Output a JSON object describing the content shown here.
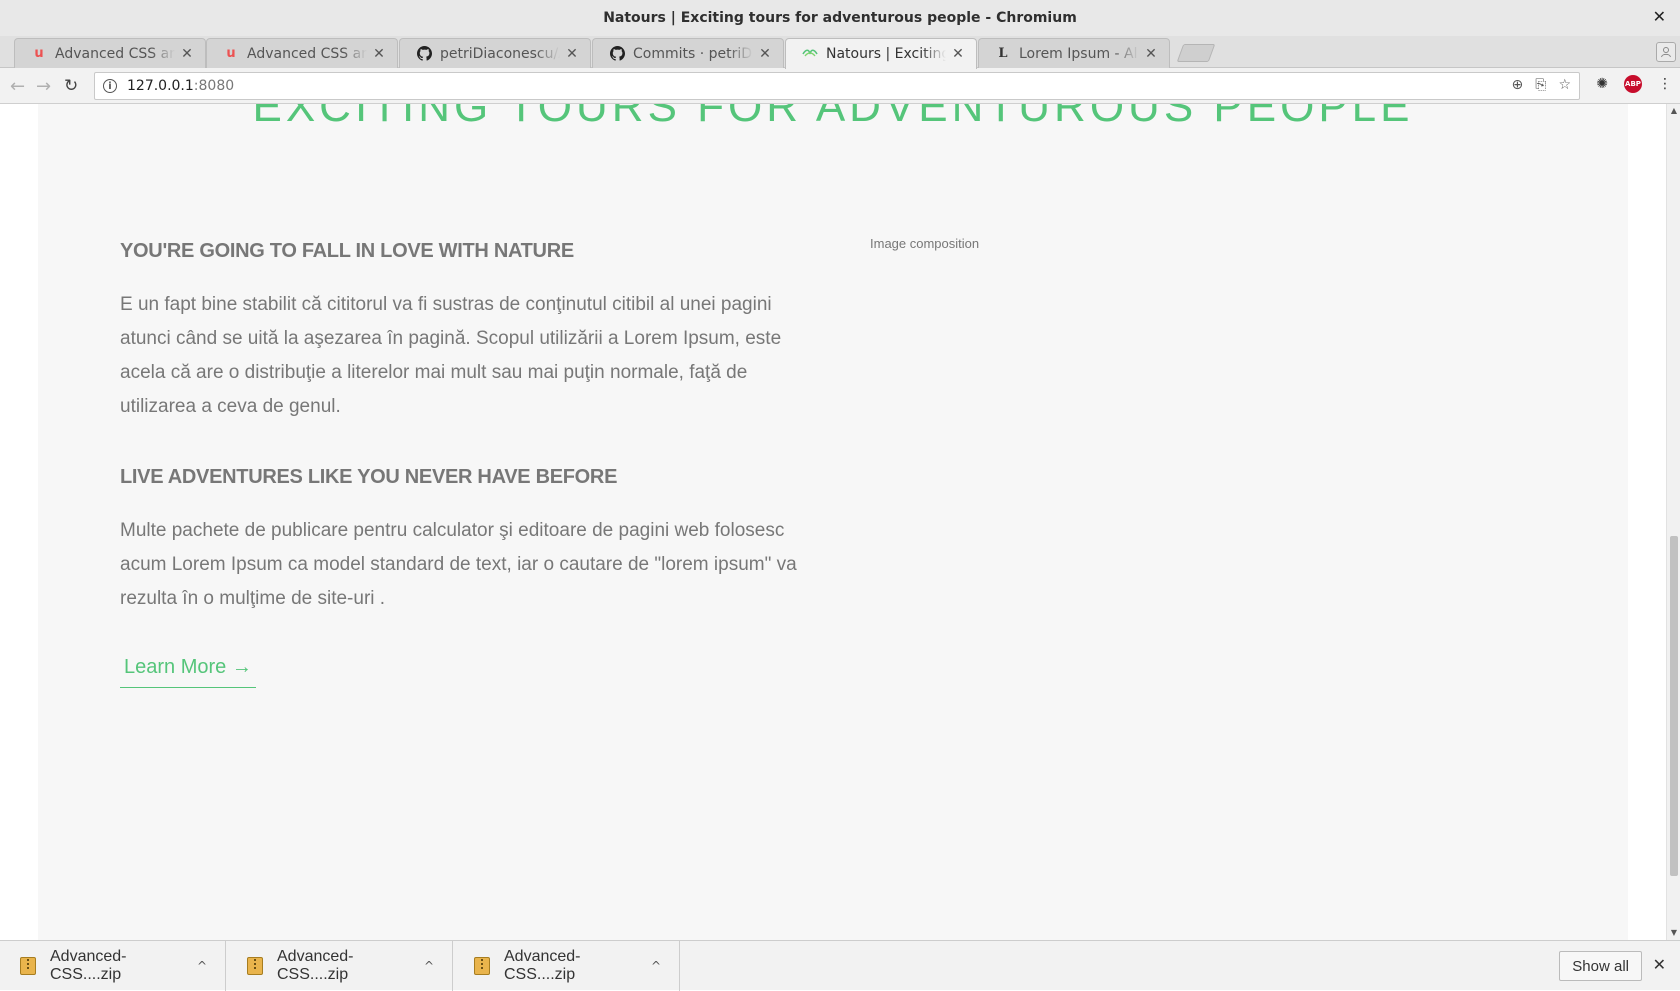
{
  "window": {
    "title": "Natours | Exciting tours for adventurous people - Chromium",
    "close_glyph": "✕"
  },
  "tabs": [
    {
      "label": "Advanced CSS and Sass",
      "icon": "u",
      "icon_color": "#ec5252",
      "active": false
    },
    {
      "label": "Advanced CSS and Sass",
      "icon": "u",
      "icon_color": "#ec5252",
      "active": false
    },
    {
      "label": "petriDiaconescu/Advanced-CSS",
      "icon": "github-icon",
      "icon_color": "#222222",
      "active": false
    },
    {
      "label": "Commits · petriDiaconescu",
      "icon": "github-icon",
      "icon_color": "#222222",
      "active": false
    },
    {
      "label": "Natours | Exciting tours",
      "icon": "natours-leaf-icon",
      "icon_color": "#55c57a",
      "active": true
    },
    {
      "label": "Lorem Ipsum - All the facts",
      "icon": "L",
      "icon_color": "#333333",
      "active": false
    }
  ],
  "tab_close_glyph": "✕",
  "toolbar": {
    "back_glyph": "←",
    "forward_glyph": "→",
    "reload_glyph": "↻",
    "url_host": "127.0.0.1",
    "url_port": ":8080",
    "info_glyph": "i",
    "zoom_glyph": "⊕",
    "translate_glyph": "⎘",
    "star_glyph": "☆",
    "ext_glyph": "✺",
    "abp_label": "ABP",
    "menu_glyph": "⋮"
  },
  "page": {
    "hero_heading": "EXCITING TOURS FOR ADVENTUROUS PEOPLE",
    "feature1_heading": "YOU'RE GOING TO FALL IN LOVE WITH NATURE",
    "feature1_text": "E un fapt bine stabilit că cititorul va fi sustras de conţinutul citibil al unei pagini atunci când se uită la aşezarea în pagină. Scopul utilizării a Lorem Ipsum, este acela că are o distribuţie a literelor mai mult sau mai puţin normale, faţă de utilizarea a ceva de genul.",
    "feature2_heading": "LIVE ADVENTURES LIKE YOU NEVER HAVE BEFORE",
    "feature2_text": "Multe pachete de publicare pentru calculator şi editoare de pagini web folosesc acum Lorem Ipsum ca model standard de text, iar o cautare de \"lorem ipsum\" va rezulta în o mulţime de site-uri .",
    "learn_more": "Learn More →",
    "image_composition": "Image composition"
  },
  "scrollbar": {
    "up_glyph": "▲",
    "down_glyph": "▼"
  },
  "downloads": {
    "items": [
      {
        "name": "Advanced-CSS....zip"
      },
      {
        "name": "Advanced-CSS....zip"
      },
      {
        "name": "Advanced-CSS....zip"
      }
    ],
    "chevron_glyph": "^",
    "show_all": "Show all",
    "close_glyph": "✕"
  },
  "colors": {
    "accent_green": "#55c57a",
    "text_grey": "#777777",
    "section_bg": "#f7f7f7"
  }
}
